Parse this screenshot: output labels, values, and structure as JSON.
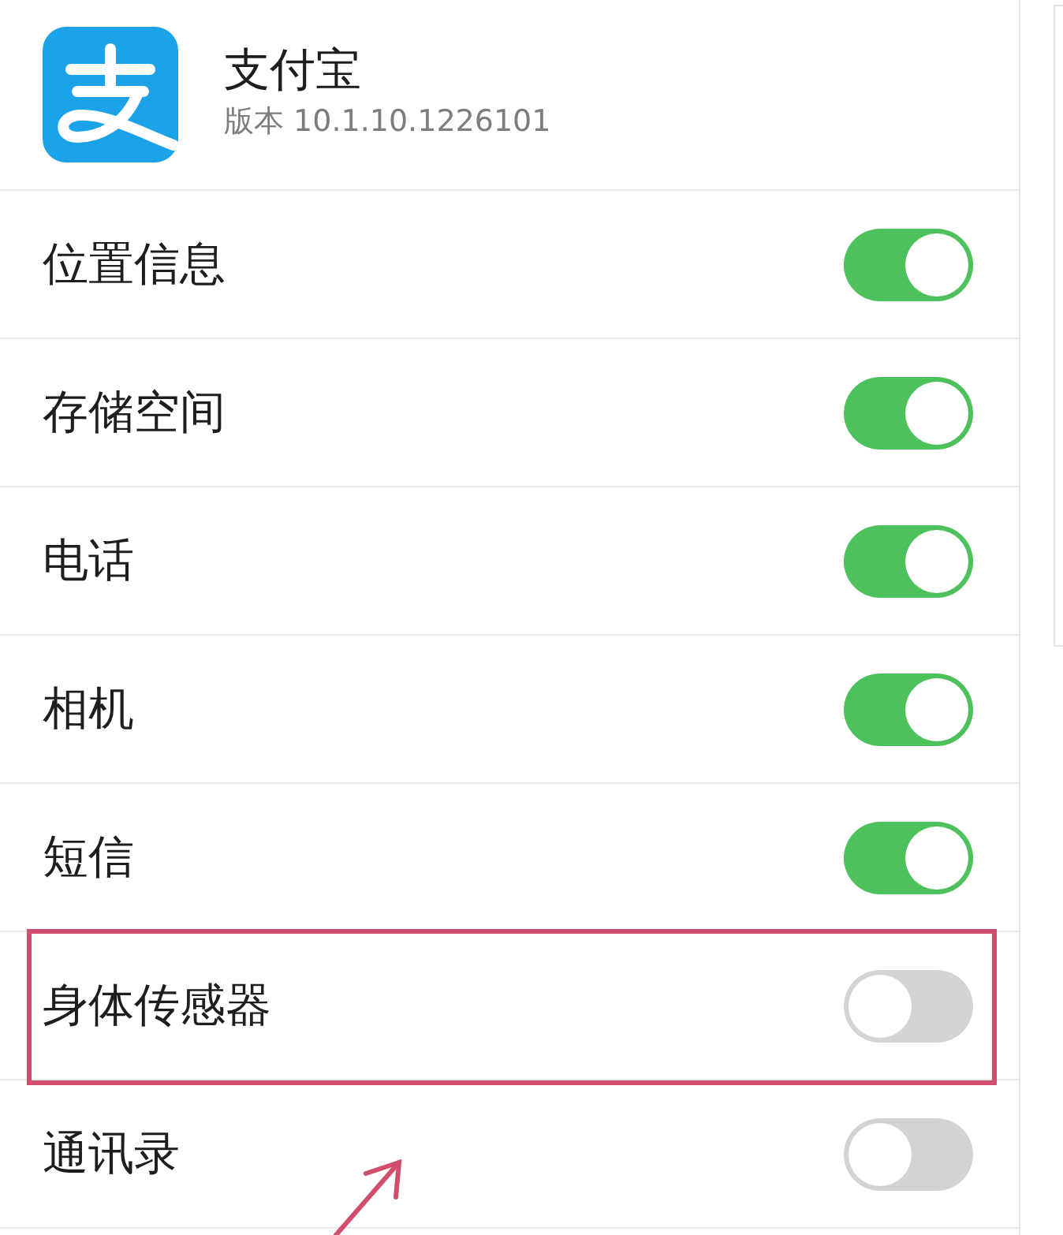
{
  "app": {
    "name": "支付宝",
    "version": "版本 10.1.10.1226101"
  },
  "permissions": [
    {
      "label": "位置信息",
      "on": true,
      "highlighted": false
    },
    {
      "label": "存储空间",
      "on": true,
      "highlighted": false
    },
    {
      "label": "电话",
      "on": true,
      "highlighted": false
    },
    {
      "label": "相机",
      "on": true,
      "highlighted": false
    },
    {
      "label": "短信",
      "on": true,
      "highlighted": false
    },
    {
      "label": "身体传感器",
      "on": false,
      "highlighted": true
    },
    {
      "label": "通讯录",
      "on": false,
      "highlighted": false
    }
  ]
}
